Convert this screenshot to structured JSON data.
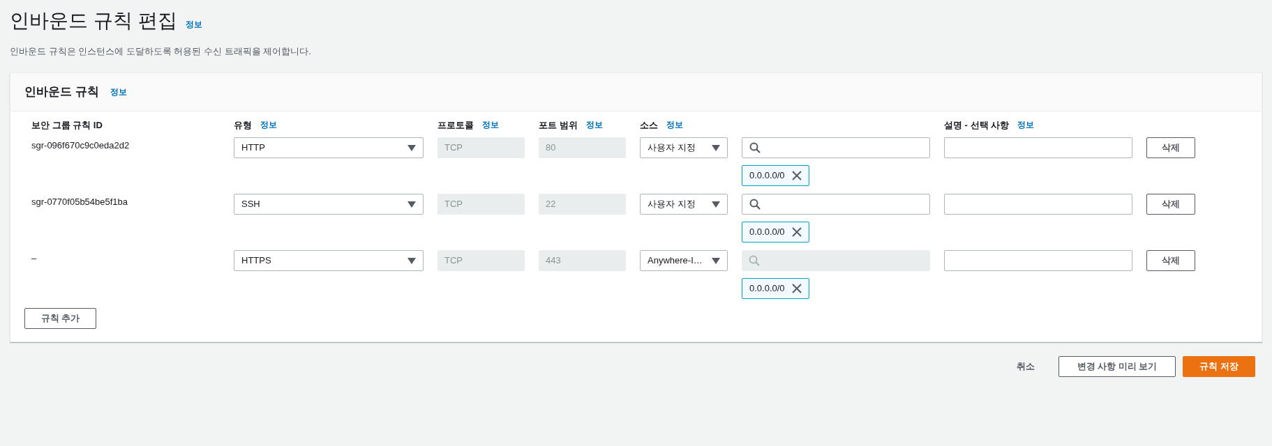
{
  "page": {
    "title": "인바운드 규칙 편집",
    "info_link": "정보",
    "description": "인바운드 규칙은 인스턴스에 도달하도록 허용된 수신 트래픽을 제어합니다."
  },
  "panel": {
    "title": "인바운드 규칙",
    "info_link": "정보",
    "columns": [
      {
        "label": "보안 그룹 규칙 ID"
      },
      {
        "label": "유형",
        "info_link": "정보"
      },
      {
        "label": "프로토콜",
        "info_link": "정보"
      },
      {
        "label": "포트 범위",
        "info_link": "정보"
      },
      {
        "label": "소스",
        "info_link": "정보"
      },
      {
        "label": "설명 - 선택 사항",
        "info_link": "정보"
      }
    ],
    "rows": [
      {
        "rule_id": "sgr-096f670c9c0eda2d2",
        "type": "HTTP",
        "protocol": "TCP",
        "port_range": "80",
        "source": "사용자 지정",
        "source_search_disabled": false,
        "cidr_tag": "0.0.0.0/0",
        "delete_button": "삭제"
      },
      {
        "rule_id": "sgr-0770f05b54be5f1ba",
        "type": "SSH",
        "protocol": "TCP",
        "port_range": "22",
        "source": "사용자 지정",
        "source_search_disabled": false,
        "cidr_tag": "0.0.0.0/0",
        "delete_button": "삭제"
      },
      {
        "rule_id": "–",
        "type": "HTTPS",
        "protocol": "TCP",
        "port_range": "443",
        "source": "Anywhere-I…",
        "source_search_disabled": true,
        "cidr_tag": "0.0.0.0/0",
        "delete_button": "삭제"
      }
    ],
    "add_button": "규칙 추가"
  },
  "footer": {
    "cancel": "취소",
    "preview_button": "변경 사항 미리 보기",
    "save_button": "규칙 저장"
  }
}
